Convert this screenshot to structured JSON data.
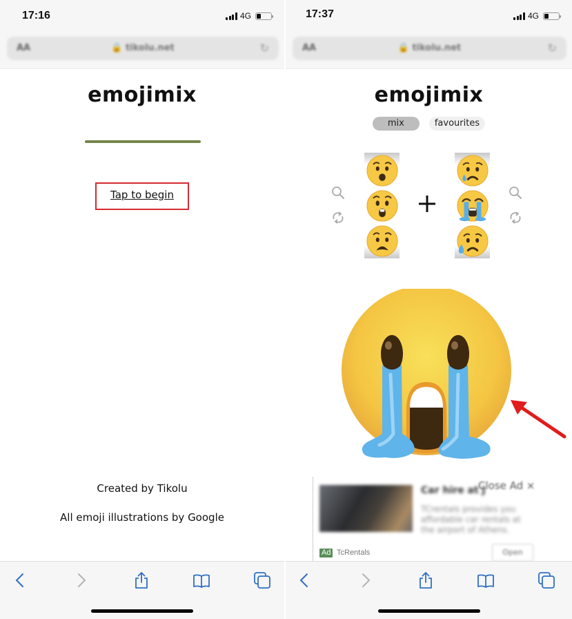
{
  "left_screen": {
    "status_bar": {
      "time": "17:16",
      "network": "4G",
      "battery_level": 0.25,
      "signal_bars": 4
    },
    "url_bar": {
      "aa_label": "AA",
      "url": "tikolu.net"
    },
    "page": {
      "title": "emojimix",
      "loading_progress": 1.0,
      "progress_color": "#75864a",
      "tap_to_begin": "Tap to begin",
      "highlight_color": "#d42a2f",
      "credit_line_1": "Created by Tikolu",
      "credit_line_2": "All emoji illustrations by Google"
    },
    "toolbar": {
      "icons": [
        "back-icon",
        "forward-icon",
        "share-icon",
        "bookmarks-icon",
        "tabs-icon"
      ],
      "accent_color": "#2f6fc4"
    }
  },
  "right_screen": {
    "status_bar": {
      "time": "17:37",
      "network": "4G",
      "battery_level": 0.25,
      "signal_bars": 4
    },
    "url_bar": {
      "aa_label": "AA",
      "url": "tikolu.net"
    },
    "page": {
      "title": "emojimix",
      "tabs": [
        {
          "label": "mix",
          "active": true
        },
        {
          "label": "favourites",
          "active": false
        }
      ],
      "left_column": {
        "emojis": [
          "hushed-face",
          "astonished-face",
          "anguished-face"
        ],
        "icons": [
          "search-icon",
          "shuffle-icon"
        ]
      },
      "operator": "+",
      "right_column": {
        "emojis": [
          "crying-face",
          "loudly-crying-face",
          "sad-but-relieved-face"
        ],
        "icons": [
          "search-icon",
          "shuffle-icon"
        ]
      },
      "result": "loudly-crying-astonished-mix",
      "annotation": "red-arrow"
    },
    "ad": {
      "headline": "Car hire at J",
      "close_label": "Close Ad ×",
      "body": "TCrentals provides you affordable car rentals at the airport of Athens.",
      "badge": "Ad",
      "advertiser": "TcRentals",
      "cta": "Open"
    },
    "toolbar": {
      "icons": [
        "back-icon",
        "forward-icon",
        "share-icon",
        "bookmarks-icon",
        "tabs-icon"
      ],
      "accent_color": "#2f6fc4"
    }
  }
}
